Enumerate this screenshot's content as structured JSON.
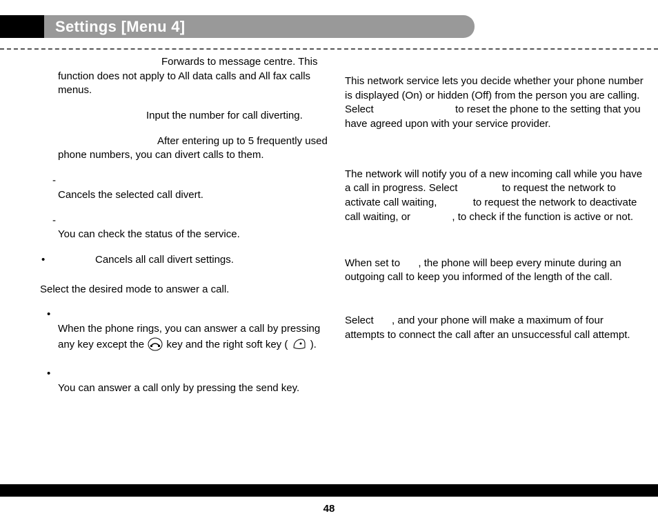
{
  "header": {
    "title": "Settings [Menu 4]"
  },
  "page_number": "48",
  "left": {
    "voicemail": "Forwards to message centre. This function does not apply to All data calls and All fax calls menus.",
    "other_prefix": "Input the number for call diverting.",
    "favorite_prefix": "After entering up to 5 frequently used phone numbers, you can divert calls to them.",
    "cancel_body": "Cancels the selected call divert.",
    "view_body": "You can check the status of the service.",
    "cancel_all": "Cancels all call divert settings.",
    "answer_heading": "Select the desired mode to answer a call.",
    "anykey_a": "When the phone rings, you can answer a call by pressing any key except the ",
    "anykey_b": " key and the right soft key ( ",
    "anykey_c": " ).",
    "sendonly": "You can answer a call only by pressing the send key."
  },
  "right": {
    "caller_id_a": "This network service lets you decide whether your phone number is displayed (On) or hidden (Off) from the person you are calling. Select ",
    "caller_id_b": " to reset the phone to the setting that you have agreed upon with your service provider.",
    "call_wait_a": "The network will notify you of a new incoming call while you have a call in progress. Select ",
    "call_wait_b": " to request the network to activate call waiting, ",
    "call_wait_c": " to request the network to deactivate call waiting, or ",
    "call_wait_d": ", to check if the function is active or not.",
    "minute_a": "When set to ",
    "minute_b": ", the phone will beep every minute during an outgoing call to keep you informed of the length of the call.",
    "redial_a": "Select ",
    "redial_b": ", and your phone will make a maximum of four attempts to connect the call after an unsuccessful call attempt."
  }
}
